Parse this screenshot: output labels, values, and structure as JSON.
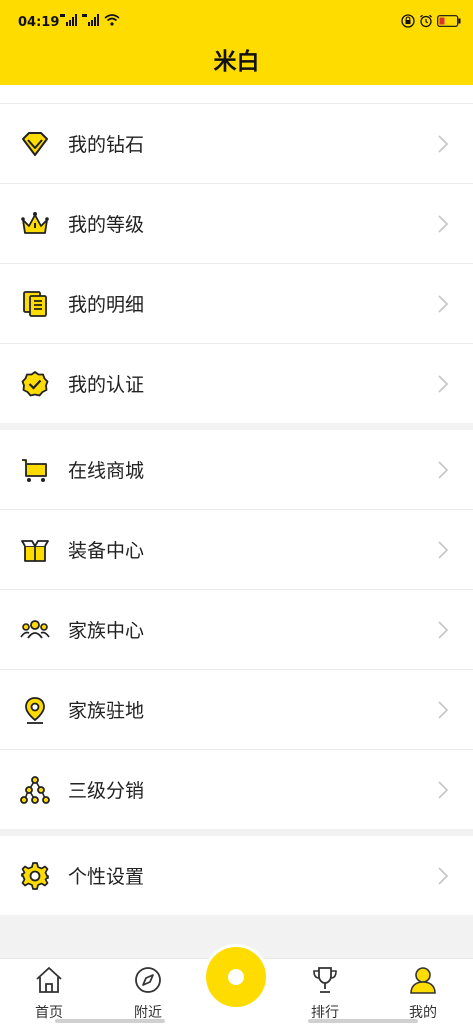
{
  "status_bar": {
    "time": "04:19"
  },
  "header": {
    "title": "米白"
  },
  "groups": [
    {
      "items": [
        {
          "label": "我的钻石",
          "icon": "diamond-icon"
        },
        {
          "label": "我的等级",
          "icon": "crown-icon"
        },
        {
          "label": "我的明细",
          "icon": "document-list-icon"
        },
        {
          "label": "我的认证",
          "icon": "verified-badge-icon"
        }
      ]
    },
    {
      "items": [
        {
          "label": "在线商城",
          "icon": "shopping-cart-icon"
        },
        {
          "label": "装备中心",
          "icon": "package-box-icon"
        },
        {
          "label": "家族中心",
          "icon": "group-people-icon"
        },
        {
          "label": "家族驻地",
          "icon": "location-pin-icon"
        },
        {
          "label": "三级分销",
          "icon": "hierarchy-icon"
        }
      ]
    },
    {
      "items": [
        {
          "label": "个性设置",
          "icon": "gear-icon"
        }
      ]
    }
  ],
  "tabbar": {
    "tabs": [
      {
        "label": "首页",
        "icon": "home-icon"
      },
      {
        "label": "附近",
        "icon": "compass-icon"
      },
      {
        "label": "排行",
        "icon": "trophy-icon"
      },
      {
        "label": "我的",
        "icon": "user-icon",
        "active": true
      }
    ],
    "center_icon": "record-button-icon"
  },
  "colors": {
    "accent": "#ffdc00",
    "background": "#f2f2f2",
    "text": "#222222"
  }
}
